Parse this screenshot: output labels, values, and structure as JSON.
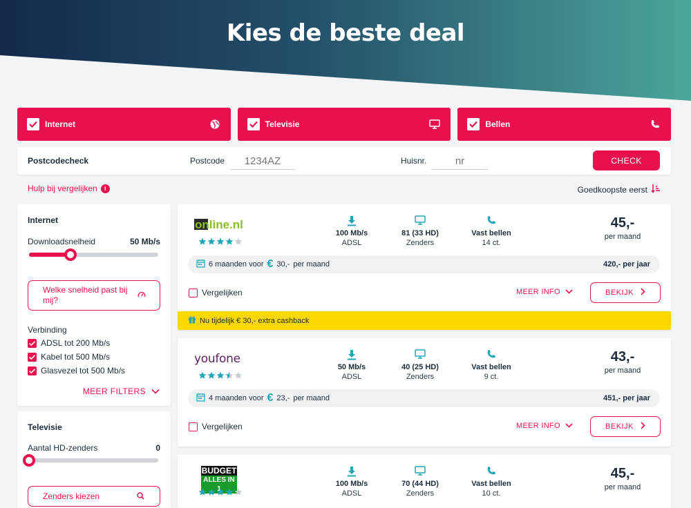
{
  "hero": {
    "title": "Kies de beste deal"
  },
  "categories": [
    {
      "label": "Internet",
      "icon": "globe-icon"
    },
    {
      "label": "Televisie",
      "icon": "monitor-icon"
    },
    {
      "label": "Bellen",
      "icon": "phone-icon"
    }
  ],
  "postcode": {
    "title": "Postcodecheck",
    "postcode_label": "Postcode",
    "postcode_placeholder": "1234AZ",
    "house_label": "Huisnr.",
    "house_placeholder": "nr",
    "button": "CHECK"
  },
  "help_link": "Hulp bij vergelijken",
  "sort_label": "Goedkoopste eerst",
  "filters": {
    "internet": {
      "title": "Internet",
      "speed_label": "Downloadsnelheid",
      "speed_value": "50 Mb/s",
      "speed_fraction": 0.32,
      "speed_help": "Welke snelheid past bij mij?",
      "connection_label": "Verbinding",
      "connections": [
        "ADSL tot 200 Mb/s",
        "Kabel tot 500 Mb/s",
        "Glasvezel tot 500 Mb/s"
      ],
      "more_filters": "MEER FILTERS"
    },
    "tv": {
      "title": "Televisie",
      "hd_label": "Aantal HD-zenders",
      "hd_value": "0",
      "hd_fraction": 0,
      "channels_button": "Zenders kiezen"
    }
  },
  "deals": [
    {
      "provider": "online.nl",
      "rating": 4,
      "speed": "100 Mb/s",
      "speed_type": "ADSL",
      "channels": "81 (33 HD)",
      "channels_label": "Zenders",
      "calling": "Vast bellen",
      "calling_rate": "14 ct.",
      "price": "45,-",
      "price_label": "per maand",
      "promo_text": "6 maanden voor",
      "promo_price": "30,-",
      "promo_suffix": "per maand",
      "yearly": "420,- per jaar",
      "compare": "Vergelijken",
      "more_info": "MEER INFO",
      "view": "BEKIJK",
      "cashback": "Nu tijdelijk € 30,- extra cashback"
    },
    {
      "provider": "youfone",
      "rating": 3.5,
      "speed": "50 Mb/s",
      "speed_type": "ADSL",
      "channels": "40 (25 HD)",
      "channels_label": "Zenders",
      "calling": "Vast bellen",
      "calling_rate": "9 ct.",
      "price": "43,-",
      "price_label": "per maand",
      "promo_text": "4 maanden voor",
      "promo_price": "23,-",
      "promo_suffix": "per maand",
      "yearly": "451,- per jaar",
      "compare": "Vergelijken",
      "more_info": "MEER INFO",
      "view": "BEKIJK"
    },
    {
      "provider_line1": "BUDGET",
      "provider_line2": "ALLES IN 1",
      "rating": 4,
      "speed": "100 Mb/s",
      "speed_type": "ADSL",
      "channels": "70 (44 HD)",
      "channels_label": "Zenders",
      "calling": "Vast bellen",
      "calling_rate": "10 ct.",
      "price": "45,-",
      "price_label": "per maand"
    }
  ],
  "colors": {
    "accent": "#e8114e",
    "teal": "#1ea6b8",
    "cashback": "#fbd800",
    "hero_dark": "#13294b",
    "hero_teal": "#4ba59a"
  }
}
